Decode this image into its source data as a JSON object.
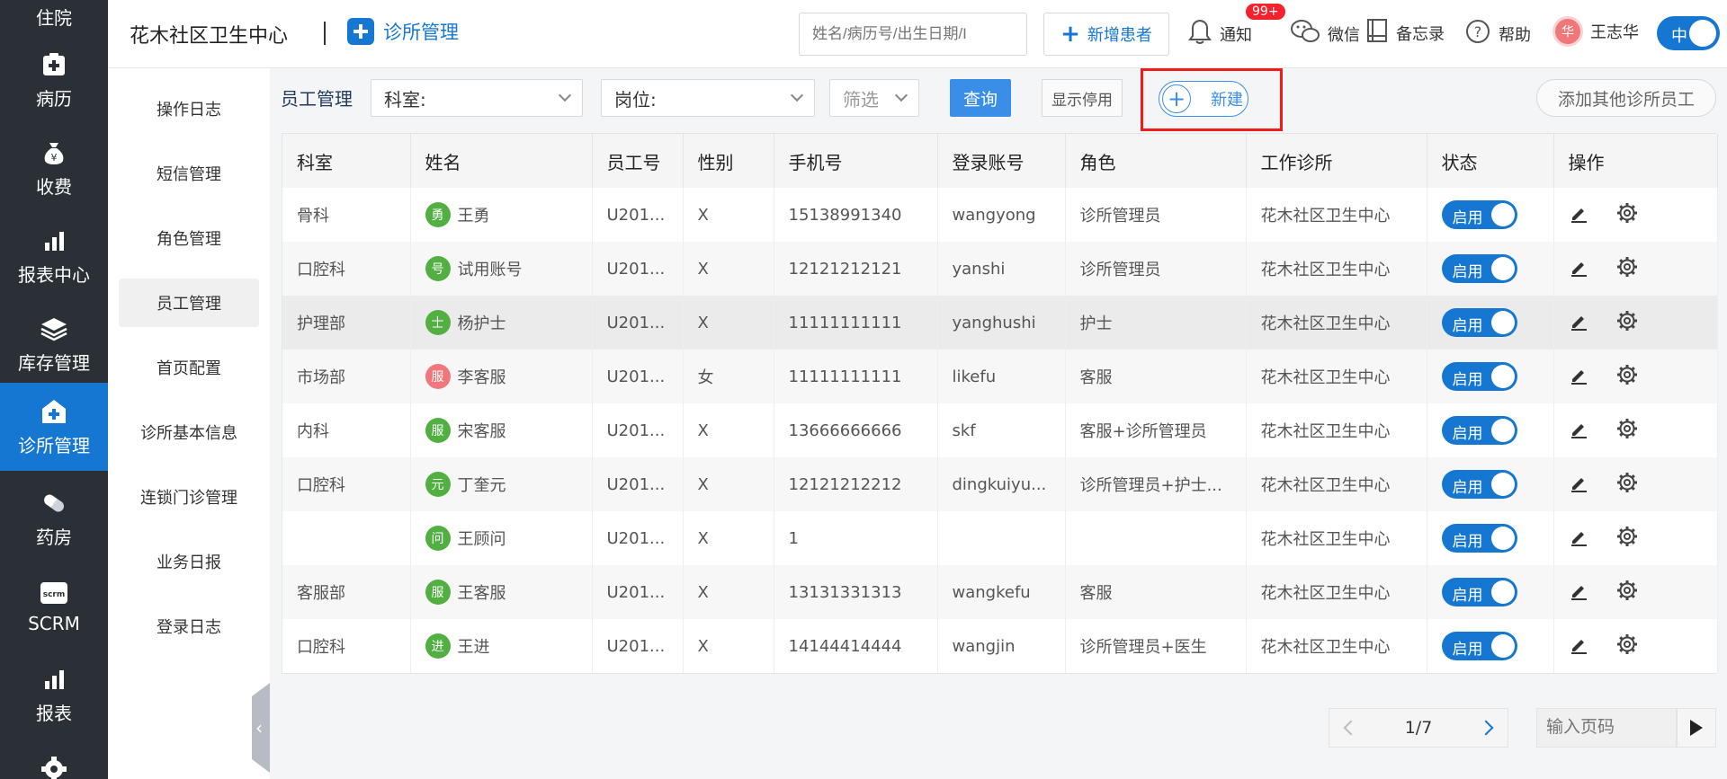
{
  "leftbar": {
    "items": [
      {
        "label": "住院",
        "icon": "hospital-icon"
      },
      {
        "label": "病历",
        "icon": "medical-record-icon"
      },
      {
        "label": "收费",
        "icon": "money-bag-icon"
      },
      {
        "label": "报表中心",
        "icon": "bar-chart-icon"
      },
      {
        "label": "库存管理",
        "icon": "layers-icon"
      },
      {
        "label": "诊所管理",
        "icon": "clinic-icon"
      },
      {
        "label": "药房",
        "icon": "pill-icon"
      },
      {
        "label": "SCRM",
        "icon": "scrm-icon"
      },
      {
        "label": "报表",
        "icon": "bar-chart-icon"
      },
      {
        "label": "",
        "icon": "gear-icon"
      }
    ],
    "active_index": 5
  },
  "header": {
    "clinic_name": "花木社区卫生中心",
    "breadcrumb": "诊所管理",
    "search_placeholder": "姓名/病历号/出生日期/I",
    "add_patient_label": "新增患者",
    "notify_label": "通知",
    "notify_badge": "99+",
    "wechat_label": "微信",
    "memo_label": "备忘录",
    "help_label": "帮助",
    "user_initial": "华",
    "user_name": "王志华",
    "lang_label": "中"
  },
  "submenu": {
    "items": [
      "操作日志",
      "短信管理",
      "角色管理",
      "员工管理",
      "首页配置",
      "诊所基本信息",
      "连锁门诊管理",
      "业务日报",
      "登录日志"
    ],
    "active_index": 3
  },
  "filters": {
    "title": "员工管理",
    "dept_label": "科室:",
    "position_label": "岗位:",
    "screen_label": "筛选",
    "query_label": "查询",
    "show_disabled_label": "显示停用",
    "new_label": "新建",
    "add_other_label": "添加其他诊所员工"
  },
  "table": {
    "columns": [
      "科室",
      "姓名",
      "员工号",
      "性别",
      "手机号",
      "登录账号",
      "角色",
      "工作诊所",
      "状态",
      "操作"
    ],
    "status_label": "启用",
    "rows": [
      {
        "dept": "骨科",
        "initial": "勇",
        "avatar_color": "#52b043",
        "name": "王勇",
        "emp_no": "U201...",
        "gender": "X",
        "phone": "15138991340",
        "account": "wangyong",
        "role": "诊所管理员",
        "clinic": "花木社区卫生中心"
      },
      {
        "dept": "口腔科",
        "initial": "号",
        "avatar_color": "#52b043",
        "name": "试用账号",
        "emp_no": "U201...",
        "gender": "X",
        "phone": "12121212121",
        "account": "yanshi",
        "role": "诊所管理员",
        "clinic": "花木社区卫生中心"
      },
      {
        "dept": "护理部",
        "initial": "士",
        "avatar_color": "#52b043",
        "name": "杨护士",
        "emp_no": "U201...",
        "gender": "X",
        "phone": "11111111111",
        "account": "yanghushi",
        "role": "护士",
        "clinic": "花木社区卫生中心"
      },
      {
        "dept": "市场部",
        "initial": "服",
        "avatar_color": "#f0787b",
        "name": "李客服",
        "emp_no": "U201...",
        "gender": "女",
        "phone": "11111111111",
        "account": "likefu",
        "role": "客服",
        "clinic": "花木社区卫生中心"
      },
      {
        "dept": "内科",
        "initial": "服",
        "avatar_color": "#52b043",
        "name": "宋客服",
        "emp_no": "U201...",
        "gender": "X",
        "phone": "13666666666",
        "account": "skf",
        "role": "客服+诊所管理员",
        "clinic": "花木社区卫生中心"
      },
      {
        "dept": "口腔科",
        "initial": "元",
        "avatar_color": "#52b043",
        "name": "丁奎元",
        "emp_no": "U201...",
        "gender": "X",
        "phone": "12121212212",
        "account": "dingkuiyu...",
        "role": "诊所管理员+护士...",
        "clinic": "花木社区卫生中心"
      },
      {
        "dept": "",
        "initial": "问",
        "avatar_color": "#52b043",
        "name": "王顾问",
        "emp_no": "U201...",
        "gender": "X",
        "phone": "1",
        "account": "",
        "role": "",
        "clinic": "花木社区卫生中心"
      },
      {
        "dept": "客服部",
        "initial": "服",
        "avatar_color": "#52b043",
        "name": "王客服",
        "emp_no": "U201...",
        "gender": "X",
        "phone": "13131331313",
        "account": "wangkefu",
        "role": "客服",
        "clinic": "花木社区卫生中心"
      },
      {
        "dept": "口腔科",
        "initial": "进",
        "avatar_color": "#52b043",
        "name": "王进",
        "emp_no": "U201...",
        "gender": "X",
        "phone": "14144414444",
        "account": "wangjin",
        "role": "诊所管理员+医生",
        "clinic": "花木社区卫生中心"
      }
    ]
  },
  "pager": {
    "page_text": "1/7",
    "goto_placeholder": "输入页码"
  },
  "colors": {
    "primary": "#1677d2",
    "sidebar_bg": "#2b2f36",
    "highlight_border": "#ee1c1c"
  }
}
